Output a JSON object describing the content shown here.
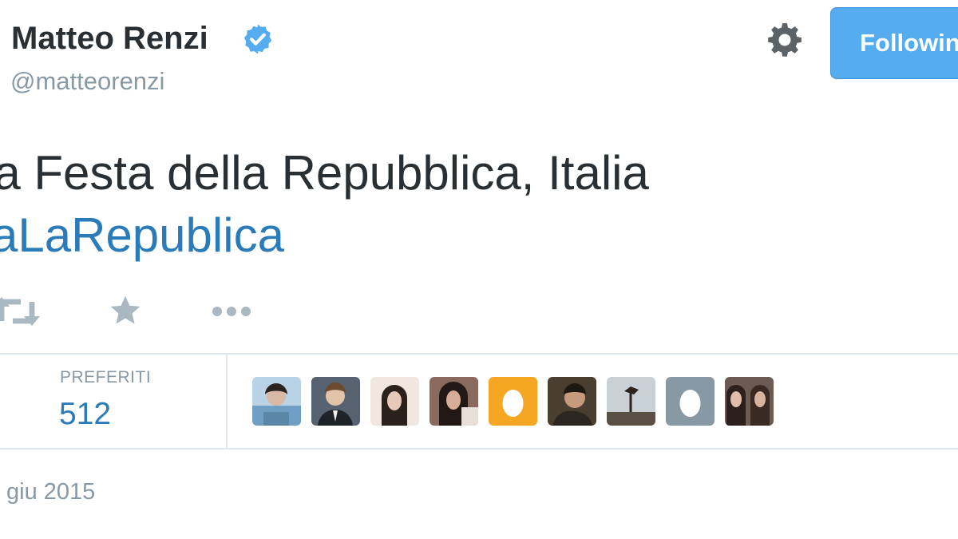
{
  "profile": {
    "display_name": "Matteo Renzi",
    "handle": "@matteorenzi",
    "verified_icon": "verified-badge-icon"
  },
  "header": {
    "settings_icon": "gear-icon",
    "follow_label": "Following"
  },
  "tweet": {
    "line1": "na Festa della Repubblica, Italia",
    "hashtag": "vaLaRepublica"
  },
  "actions": {
    "retweet_icon": "retweet-icon",
    "favorite_icon": "star-icon",
    "more_icon": "more-dots-icon"
  },
  "stats": {
    "favorites_label": "PREFERITI",
    "favorites_count": "512"
  },
  "favoriters": [
    {
      "name": "avatar-1",
      "bg": "#7fa8c9"
    },
    {
      "name": "avatar-2",
      "bg": "#4b5563"
    },
    {
      "name": "avatar-3",
      "bg": "#e8d9d2"
    },
    {
      "name": "avatar-4",
      "bg": "#6b4e46"
    },
    {
      "name": "avatar-5-default-egg",
      "bg": "#f5a623"
    },
    {
      "name": "avatar-6",
      "bg": "#3b3328"
    },
    {
      "name": "avatar-7",
      "bg": "#a8b4bd"
    },
    {
      "name": "avatar-8-default-egg",
      "bg": "#8899a6"
    },
    {
      "name": "avatar-9",
      "bg": "#5a4a44"
    }
  ],
  "footer": {
    "date": "giu 2015"
  },
  "colors": {
    "accent": "#55acee",
    "link": "#2b7bb9",
    "text": "#292f33",
    "muted": "#8899a6",
    "border": "#e1e8ed"
  }
}
